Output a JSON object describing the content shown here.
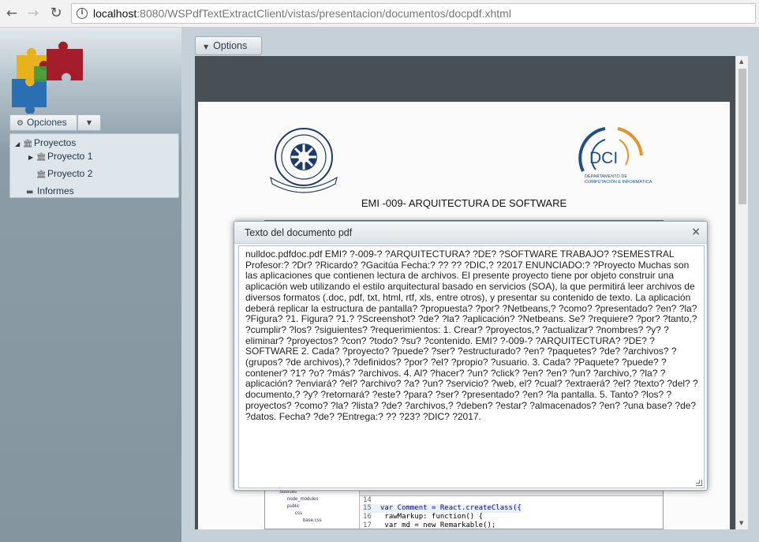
{
  "browser": {
    "back_icon": "←",
    "forward_icon": "→",
    "reload_icon": "↻",
    "info_icon": "i",
    "url_host": "localhost",
    "url_rest": ":8080/WSPdfTextExtractClient/vistas/presentacion/documentos/docpdf.xhtml"
  },
  "sidebar": {
    "opciones_label": "Opciones",
    "opciones_icon": "⚙",
    "dropdown_icon": "▼",
    "tree": {
      "proyectos": "Proyectos",
      "proyecto_1": "Proyecto 1",
      "proyecto_2": "Proyecto 2",
      "informes": "Informes",
      "expanded_icon": "◢",
      "collapsed_icon": "▶",
      "project_icon": "🏛",
      "folder_icon": "▬"
    }
  },
  "main": {
    "options_label": "Options",
    "options_icon": "▼"
  },
  "pdf": {
    "heading": "EMI -009- ARQUITECTURA DE SOFTWARE",
    "dci_logo_text": "DCI",
    "dci_logo_sub1": "DEPARTAMENTO DE",
    "dci_logo_sub2": "COMPUTACIÓN E INFORMÁTICA",
    "code_lines": [
      {
        "num": "14",
        "code": ""
      },
      {
        "num": "15",
        "code": "var Comment = React.createClass({"
      },
      {
        "num": "16",
        "code": "  rawMarkup: function() {"
      },
      {
        "num": "17",
        "code": "    var md = new Remarkable();"
      }
    ],
    "file_tree": [
      "Sources",
      "node_modules",
      "public",
      "css",
      "base.css"
    ]
  },
  "dialog": {
    "title": "Texto del documento pdf",
    "close_icon": "×",
    "text": "nulldoc.pdfdoc.pdf EMI? ?-009-? ?ARQUITECTURA? ?DE? ?SOFTWARE TRABAJO? ?SEMESTRAL Profesor:? ?Dr? ?Ricardo? ?Gacitúa Fecha:? ?? ?? ?DIC,? ?2017 ENUNCIADO:? ?Proyecto Muchas son las aplicaciones que contienen lectura de archivos. El presente proyecto tiene por objeto construir una aplicación web utilizando el estilo arquitectural basado en servicios (SOA), la que permitirá leer archivos de diversos formatos (.doc, pdf, txt, html, rtf, xls, entre otros), y presentar su contenido de texto. La aplicación deberá replicar la estructura de pantalla? ?propuesta? ?por? ?Netbeans,? ?como? ?presentado? ?en? ?la? ?Figura? ?1. Figura? ?1.? ?Screenshot? ?de? ?la? ?aplicación? ?Netbeans. Se? ?requiere? ?por? ?tanto,? ?cumplir? ?los? ?siguientes? ?requerimientos: 1. Crear? ?proyectos,? ?actualizar? ?nombres? ?y? ?eliminar? ?proyectos? ?con? ?todo? ?su? ?contenido. EMI? ?-009-? ?ARQUITECTURA? ?DE? ?SOFTWARE 2. Cada? ?proyecto? ?puede? ?ser? ?estructurado? ?en? ?paquetes? ?de? ?archivos? ?(grupos? ?de archivos),? ?definidos? ?por? ?el? ?propio? ?usuario. 3. Cada? ?Paquete? ?puede? ?contener? ?1? ?o? ?más? ?archivos. 4. Al? ?hacer? ?un? ?click? ?en? ?en? ?un? ?archivo,? ?la? ?aplicación? ?enviará? ?el? ?archivo? ?a? ?un? ?servicio? ?web, el? ?cual? ?extraerá? ?el? ?texto? ?del? ?documento,? ?y? ?retornará? ?este? ?para? ?ser? ?presentado? ?en? ?la pantalla. 5. Tanto? ?los? ?proyectos? ?como? ?la? ?lista? ?de? ?archivos,? ?deben? ?estar? ?almacenados? ?en? ?una base? ?de? ?datos. Fecha? ?de? ?Entrega:? ?? ?23? ?DIC? ?2017."
  }
}
